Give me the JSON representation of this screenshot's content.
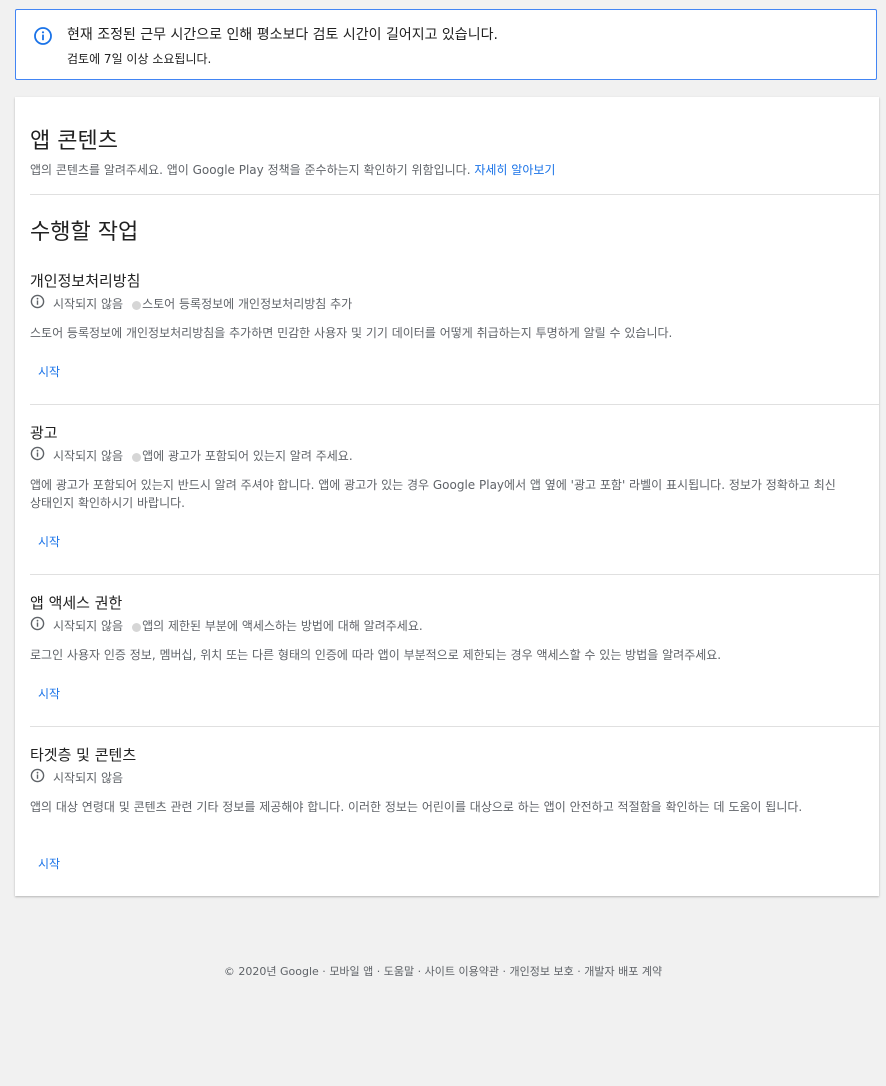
{
  "notice": {
    "line1": "현재 조정된 근무 시간으로 인해 평소보다 검토 시간이 길어지고 있습니다.",
    "line2": "검토에 7일 이상 소요됩니다."
  },
  "content": {
    "title": "앱 콘텐츠",
    "description": "앱의 콘텐츠를 알려주세요. 앱이 Google Play 정책을 준수하는지 확인하기 위함입니다.",
    "learn_more": "자세히 알아보기",
    "tasks_title": "수행할 작업"
  },
  "tasks": [
    {
      "title": "개인정보처리방침",
      "status": "시작되지 않음",
      "subtitle": "스토어 등록정보에 개인정보처리방침 추가",
      "description": "스토어 등록정보에 개인정보처리방침을 추가하면 민감한 사용자 및 기기 데이터를 어떻게 취급하는지 투명하게 알릴 수 있습니다.",
      "action": "시작"
    },
    {
      "title": "광고",
      "status": "시작되지 않음",
      "subtitle": "앱에 광고가 포함되어 있는지 알려 주세요.",
      "description": "앱에 광고가 포함되어 있는지 반드시 알려 주셔야 합니다. 앱에 광고가 있는 경우 Google Play에서 앱 옆에 '광고 포함' 라벨이 표시됩니다. 정보가 정확하고 최신 상태인지 확인하시기 바랍니다.",
      "action": "시작"
    },
    {
      "title": "앱 액세스 권한",
      "status": "시작되지 않음",
      "subtitle": "앱의 제한된 부분에 액세스하는 방법에 대해 알려주세요.",
      "description": "로그인 사용자 인증 정보, 멤버십, 위치 또는 다른 형태의 인증에 따라 앱이 부분적으로 제한되는 경우 액세스할 수 있는 방법을 알려주세요.",
      "action": "시작"
    },
    {
      "title": "타겟층 및 콘텐츠",
      "status": "시작되지 않음",
      "subtitle": "",
      "description": "앱의 대상 연령대 및 콘텐츠 관련 기타 정보를 제공해야 합니다. 이러한 정보는 어린이를 대상으로 하는 앱이 안전하고 적절함을 확인하는 데 도움이 됩니다.",
      "action": "시작"
    }
  ],
  "footer": {
    "copyright": "© 2020년 Google",
    "sep": " · ",
    "links": [
      "모바일 앱",
      "도움말",
      "사이트 이용약관",
      "개인정보 보호",
      "개발자 배포 계약"
    ]
  },
  "colors": {
    "accent": "#1a73e8",
    "info_icon": "#5f6368",
    "notice_border": "#4285f4"
  }
}
